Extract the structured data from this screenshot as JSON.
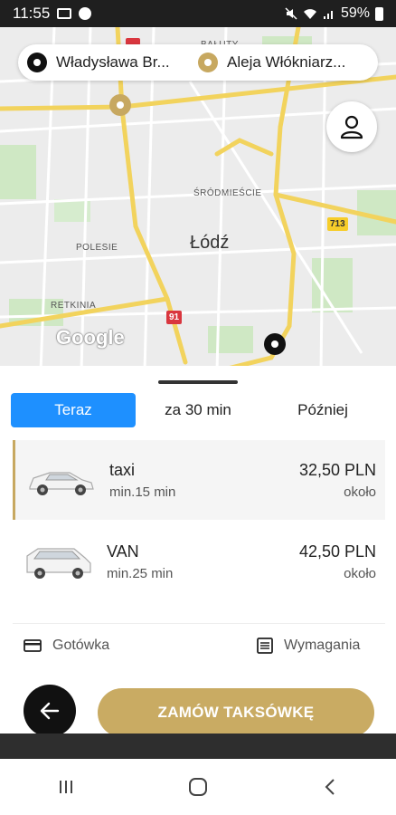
{
  "status_bar": {
    "time": "11:55",
    "battery": "59%"
  },
  "map": {
    "labels": {
      "srodmiescie": "ŚRÓDMIEŚCIE",
      "polesie": "POLESIE",
      "retkinia": "RETKINIA",
      "city": "Łódź",
      "top_fragment": "BAŁUTY"
    },
    "road_badges": {
      "r91": "91",
      "r713": "713"
    },
    "google_logo": "Google"
  },
  "route": {
    "from": "Władysława Br...",
    "to": "Aleja Włókniarz..."
  },
  "tabs": [
    {
      "label": "Teraz",
      "active": true
    },
    {
      "label": "za 30 min",
      "active": false
    },
    {
      "label": "Później",
      "active": false
    }
  ],
  "rides": [
    {
      "name": "taxi",
      "time": "min.15 min",
      "price": "32,50 PLN",
      "approx": "około",
      "selected": true
    },
    {
      "name": "VAN",
      "time": "min.25 min",
      "price": "42,50 PLN",
      "approx": "około",
      "selected": false
    }
  ],
  "payment": {
    "label": "Gotówka"
  },
  "requirements": {
    "label": "Wymagania"
  },
  "order_button": {
    "label": "ZAMÓW TAKSÓWKĘ"
  },
  "colors": {
    "accent_gold": "#c9ab63",
    "tab_blue": "#1e90ff",
    "road_yellow": "#f6cd2a"
  }
}
